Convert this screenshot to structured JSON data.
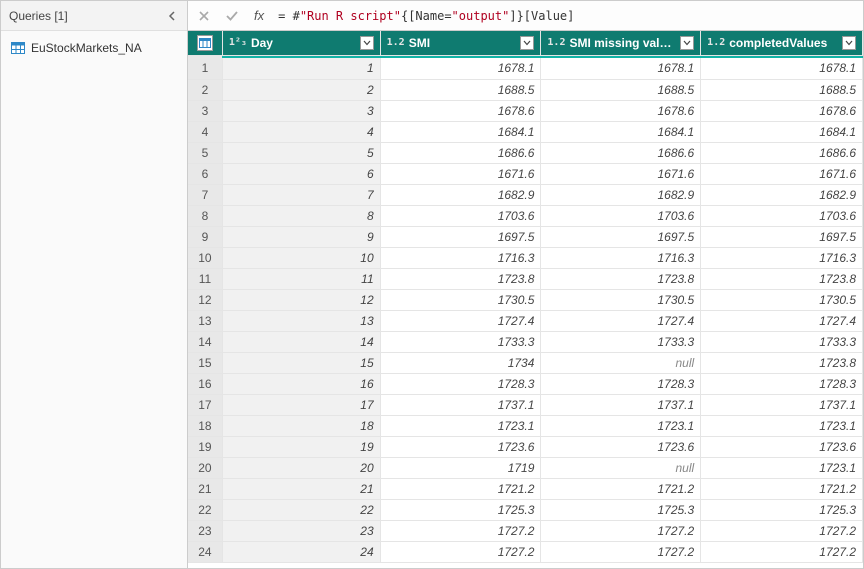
{
  "sidebar": {
    "title": "Queries [1]",
    "items": [
      {
        "label": "EuStockMarkets_NA"
      }
    ]
  },
  "formula_bar": {
    "fx": "fx",
    "prefix": "= #",
    "q1": "\"Run R script\"",
    "mid1": "{[Name=",
    "q2": "\"output\"",
    "mid2": "]}[Value]"
  },
  "columns": [
    {
      "type": "1²₃",
      "label": "Day"
    },
    {
      "type": "1.2",
      "label": "SMI"
    },
    {
      "type": "1.2",
      "label": "SMI missing values"
    },
    {
      "type": "1.2",
      "label": "completedValues"
    }
  ],
  "rows": [
    {
      "n": "1",
      "day": "1",
      "smi": "1678.1",
      "miss": "1678.1",
      "comp": "1678.1"
    },
    {
      "n": "2",
      "day": "2",
      "smi": "1688.5",
      "miss": "1688.5",
      "comp": "1688.5"
    },
    {
      "n": "3",
      "day": "3",
      "smi": "1678.6",
      "miss": "1678.6",
      "comp": "1678.6"
    },
    {
      "n": "4",
      "day": "4",
      "smi": "1684.1",
      "miss": "1684.1",
      "comp": "1684.1"
    },
    {
      "n": "5",
      "day": "5",
      "smi": "1686.6",
      "miss": "1686.6",
      "comp": "1686.6"
    },
    {
      "n": "6",
      "day": "6",
      "smi": "1671.6",
      "miss": "1671.6",
      "comp": "1671.6"
    },
    {
      "n": "7",
      "day": "7",
      "smi": "1682.9",
      "miss": "1682.9",
      "comp": "1682.9"
    },
    {
      "n": "8",
      "day": "8",
      "smi": "1703.6",
      "miss": "1703.6",
      "comp": "1703.6"
    },
    {
      "n": "9",
      "day": "9",
      "smi": "1697.5",
      "miss": "1697.5",
      "comp": "1697.5"
    },
    {
      "n": "10",
      "day": "10",
      "smi": "1716.3",
      "miss": "1716.3",
      "comp": "1716.3"
    },
    {
      "n": "11",
      "day": "11",
      "smi": "1723.8",
      "miss": "1723.8",
      "comp": "1723.8"
    },
    {
      "n": "12",
      "day": "12",
      "smi": "1730.5",
      "miss": "1730.5",
      "comp": "1730.5"
    },
    {
      "n": "13",
      "day": "13",
      "smi": "1727.4",
      "miss": "1727.4",
      "comp": "1727.4"
    },
    {
      "n": "14",
      "day": "14",
      "smi": "1733.3",
      "miss": "1733.3",
      "comp": "1733.3"
    },
    {
      "n": "15",
      "day": "15",
      "smi": "1734",
      "miss": "null",
      "comp": "1723.8",
      "miss_null": true
    },
    {
      "n": "16",
      "day": "16",
      "smi": "1728.3",
      "miss": "1728.3",
      "comp": "1728.3"
    },
    {
      "n": "17",
      "day": "17",
      "smi": "1737.1",
      "miss": "1737.1",
      "comp": "1737.1"
    },
    {
      "n": "18",
      "day": "18",
      "smi": "1723.1",
      "miss": "1723.1",
      "comp": "1723.1"
    },
    {
      "n": "19",
      "day": "19",
      "smi": "1723.6",
      "miss": "1723.6",
      "comp": "1723.6"
    },
    {
      "n": "20",
      "day": "20",
      "smi": "1719",
      "miss": "null",
      "comp": "1723.1",
      "miss_null": true
    },
    {
      "n": "21",
      "day": "21",
      "smi": "1721.2",
      "miss": "1721.2",
      "comp": "1721.2"
    },
    {
      "n": "22",
      "day": "22",
      "smi": "1725.3",
      "miss": "1725.3",
      "comp": "1725.3"
    },
    {
      "n": "23",
      "day": "23",
      "smi": "1727.2",
      "miss": "1727.2",
      "comp": "1727.2"
    },
    {
      "n": "24",
      "day": "24",
      "smi": "1727.2",
      "miss": "1727.2",
      "comp": "1727.2"
    }
  ]
}
